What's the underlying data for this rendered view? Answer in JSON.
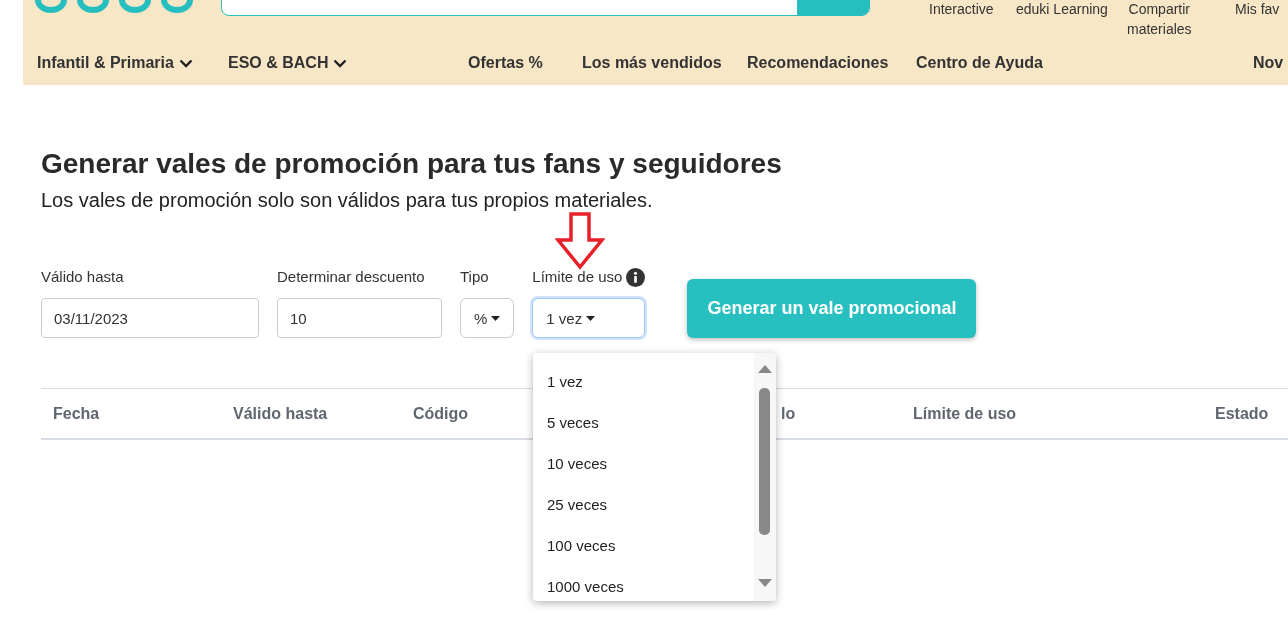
{
  "header": {
    "top_links": [
      {
        "label": "Interactive"
      },
      {
        "label": "eduki Learning"
      },
      {
        "label": "Compartir materiales"
      },
      {
        "label": "Mis fav"
      }
    ],
    "nav": [
      {
        "label": "Infantil & Primaria",
        "has_menu": true
      },
      {
        "label": "ESO & BACH",
        "has_menu": true
      },
      {
        "label": "Ofertas %",
        "has_menu": false
      },
      {
        "label": "Los más vendidos",
        "has_menu": false
      },
      {
        "label": "Recomendaciones",
        "has_menu": false
      },
      {
        "label": "Centro de Ayuda",
        "has_menu": false
      },
      {
        "label": "Nov",
        "has_menu": false
      }
    ]
  },
  "title": "Generar vales de promoción para tus fans y seguidores",
  "subtitle": "Los vales de promoción solo son válidos para tus propios materiales.",
  "form": {
    "fields": [
      {
        "kind": "input",
        "label": "Válido hasta",
        "value": "03/11/2023"
      },
      {
        "kind": "input",
        "label": "Determinar descuento",
        "value": "10"
      },
      {
        "kind": "select",
        "label": "Tipo",
        "value": "%",
        "focused": false
      },
      {
        "kind": "select",
        "label": "Límite de uso",
        "value": "1 vez",
        "focused": true,
        "info": true
      }
    ],
    "button": "Generar un vale promocional"
  },
  "dropdown": {
    "options": [
      "1 vez",
      "5 veces",
      "10 veces",
      "25 veces",
      "100 veces",
      "1000 veces"
    ]
  },
  "table": {
    "columns": [
      "Fecha",
      "Válido hasta",
      "Código",
      "lo",
      "Límite de uso",
      "Estado"
    ]
  }
}
